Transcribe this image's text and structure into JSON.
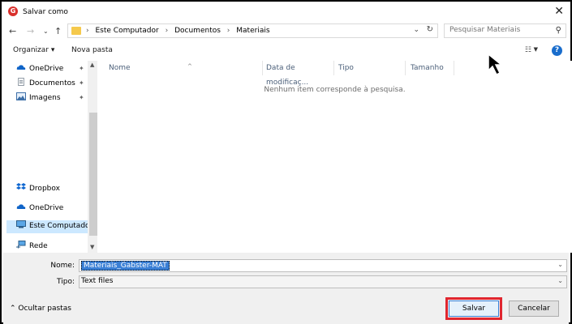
{
  "window": {
    "title": "Salvar como",
    "app_icon": "gabster-app-icon"
  },
  "address_bar": {
    "breadcrumbs": [
      "Este Computador",
      "Documentos",
      "Materiais"
    ],
    "search_placeholder": "Pesquisar Materiais"
  },
  "toolbar": {
    "organize_label": "Organizar ▾",
    "new_folder_label": "Nova pasta"
  },
  "nav_pane": {
    "quick_access": [
      {
        "label": "OneDrive",
        "icon": "onedrive-icon",
        "pinned": true
      },
      {
        "label": "Documentos",
        "icon": "document-icon",
        "pinned": true
      },
      {
        "label": "Imagens",
        "icon": "image-icon",
        "pinned": true
      }
    ],
    "locations": [
      {
        "label": "Dropbox",
        "icon": "dropbox-icon"
      },
      {
        "label": "OneDrive",
        "icon": "onedrive-icon"
      },
      {
        "label": "Este Computador",
        "icon": "computer-icon",
        "selected": true
      },
      {
        "label": "Rede",
        "icon": "network-icon"
      }
    ]
  },
  "file_list": {
    "columns": [
      "Nome",
      "Data de modificaç...",
      "Tipo",
      "Tamanho"
    ],
    "empty_message": "Nenhum item corresponde à pesquisa."
  },
  "form": {
    "name_label": "Nome:",
    "name_value": "Materiais_Gabster-MAT",
    "type_label": "Tipo:",
    "type_value": "Text files"
  },
  "footer": {
    "hide_folders_label": "Ocultar pastas",
    "save_label": "Salvar",
    "cancel_label": "Cancelar"
  },
  "colors": {
    "highlight": "#e0262f",
    "selection": "#3a7fd5",
    "nav_selected": "#cce8ff"
  }
}
